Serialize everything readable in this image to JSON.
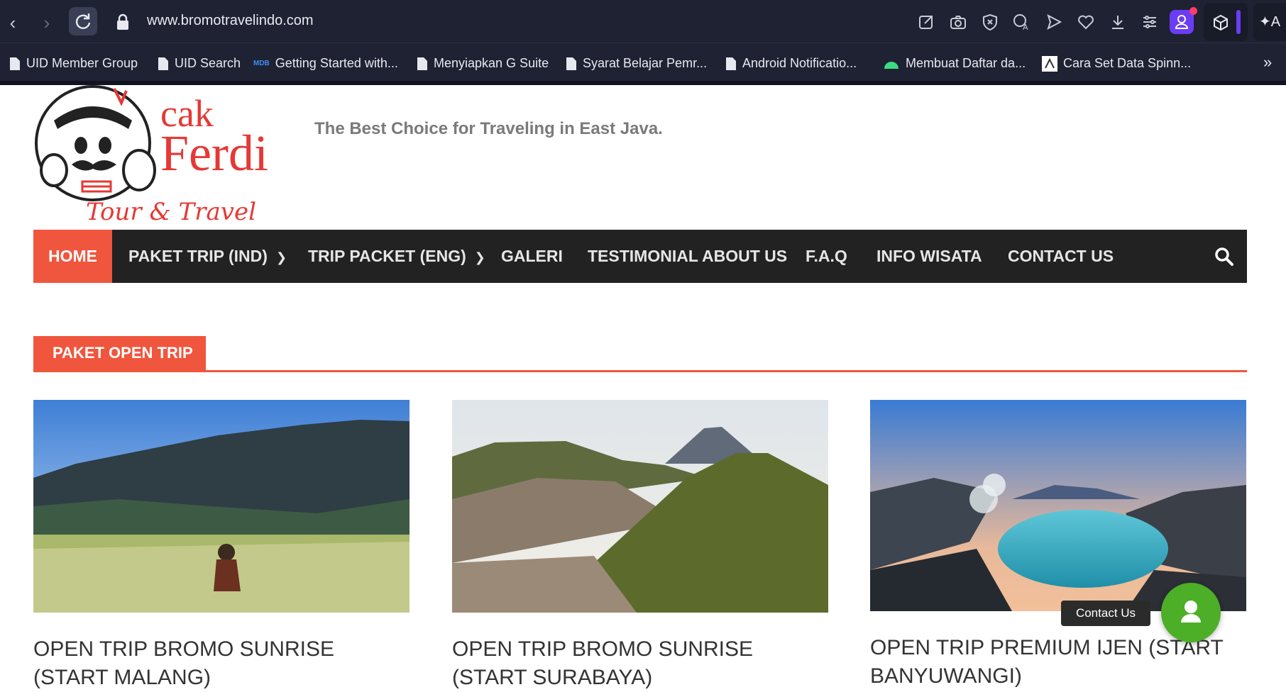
{
  "browser": {
    "url": "www.bromotravelindo.com",
    "profile_color": "#6b3cf5",
    "ai_label": "A",
    "bookmarks": [
      {
        "label": "UID Member Group",
        "icon": "page-icon"
      },
      {
        "label": "UID Search",
        "icon": "page-icon"
      },
      {
        "label": "Getting Started with...",
        "icon": "mdb-icon"
      },
      {
        "label": "Menyiapkan G Suite",
        "icon": "page-icon"
      },
      {
        "label": "Syarat Belajar Pemr...",
        "icon": "page-icon"
      },
      {
        "label": "Android Notificatio...",
        "icon": "page-icon"
      },
      {
        "label": "Membuat Daftar da...",
        "icon": "android-icon"
      },
      {
        "label": "Cara Set Data Spinn...",
        "icon": "site-icon"
      }
    ],
    "more_label": "»"
  },
  "site": {
    "logo_text_1": "cak",
    "logo_text_2": "Ferdi",
    "logo_sub": "Tour & Travel",
    "tagline": "The Best Choice for Traveling in East Java.",
    "accent": "#f0553d",
    "nav": [
      {
        "label": "HOME",
        "active": true
      },
      {
        "label": "PAKET TRIP (IND)",
        "dropdown": true
      },
      {
        "label": "TRIP PACKET (ENG)",
        "dropdown": true
      },
      {
        "label": "GALERI"
      },
      {
        "label": "TESTIMONIAL ABOUT US"
      },
      {
        "label": "F.A.Q"
      },
      {
        "label": "INFO WISATA"
      },
      {
        "label": "CONTACT US"
      }
    ],
    "section_title": "PAKET OPEN TRIP",
    "cards": [
      {
        "title": "OPEN TRIP BROMO SUNRISE (START MALANG)"
      },
      {
        "title": "OPEN TRIP BROMO SUNRISE (START SURABAYA)"
      },
      {
        "title": "OPEN TRIP PREMIUM IJEN (START BANYUWANGI)"
      }
    ],
    "contact_tooltip": "Contact Us"
  }
}
